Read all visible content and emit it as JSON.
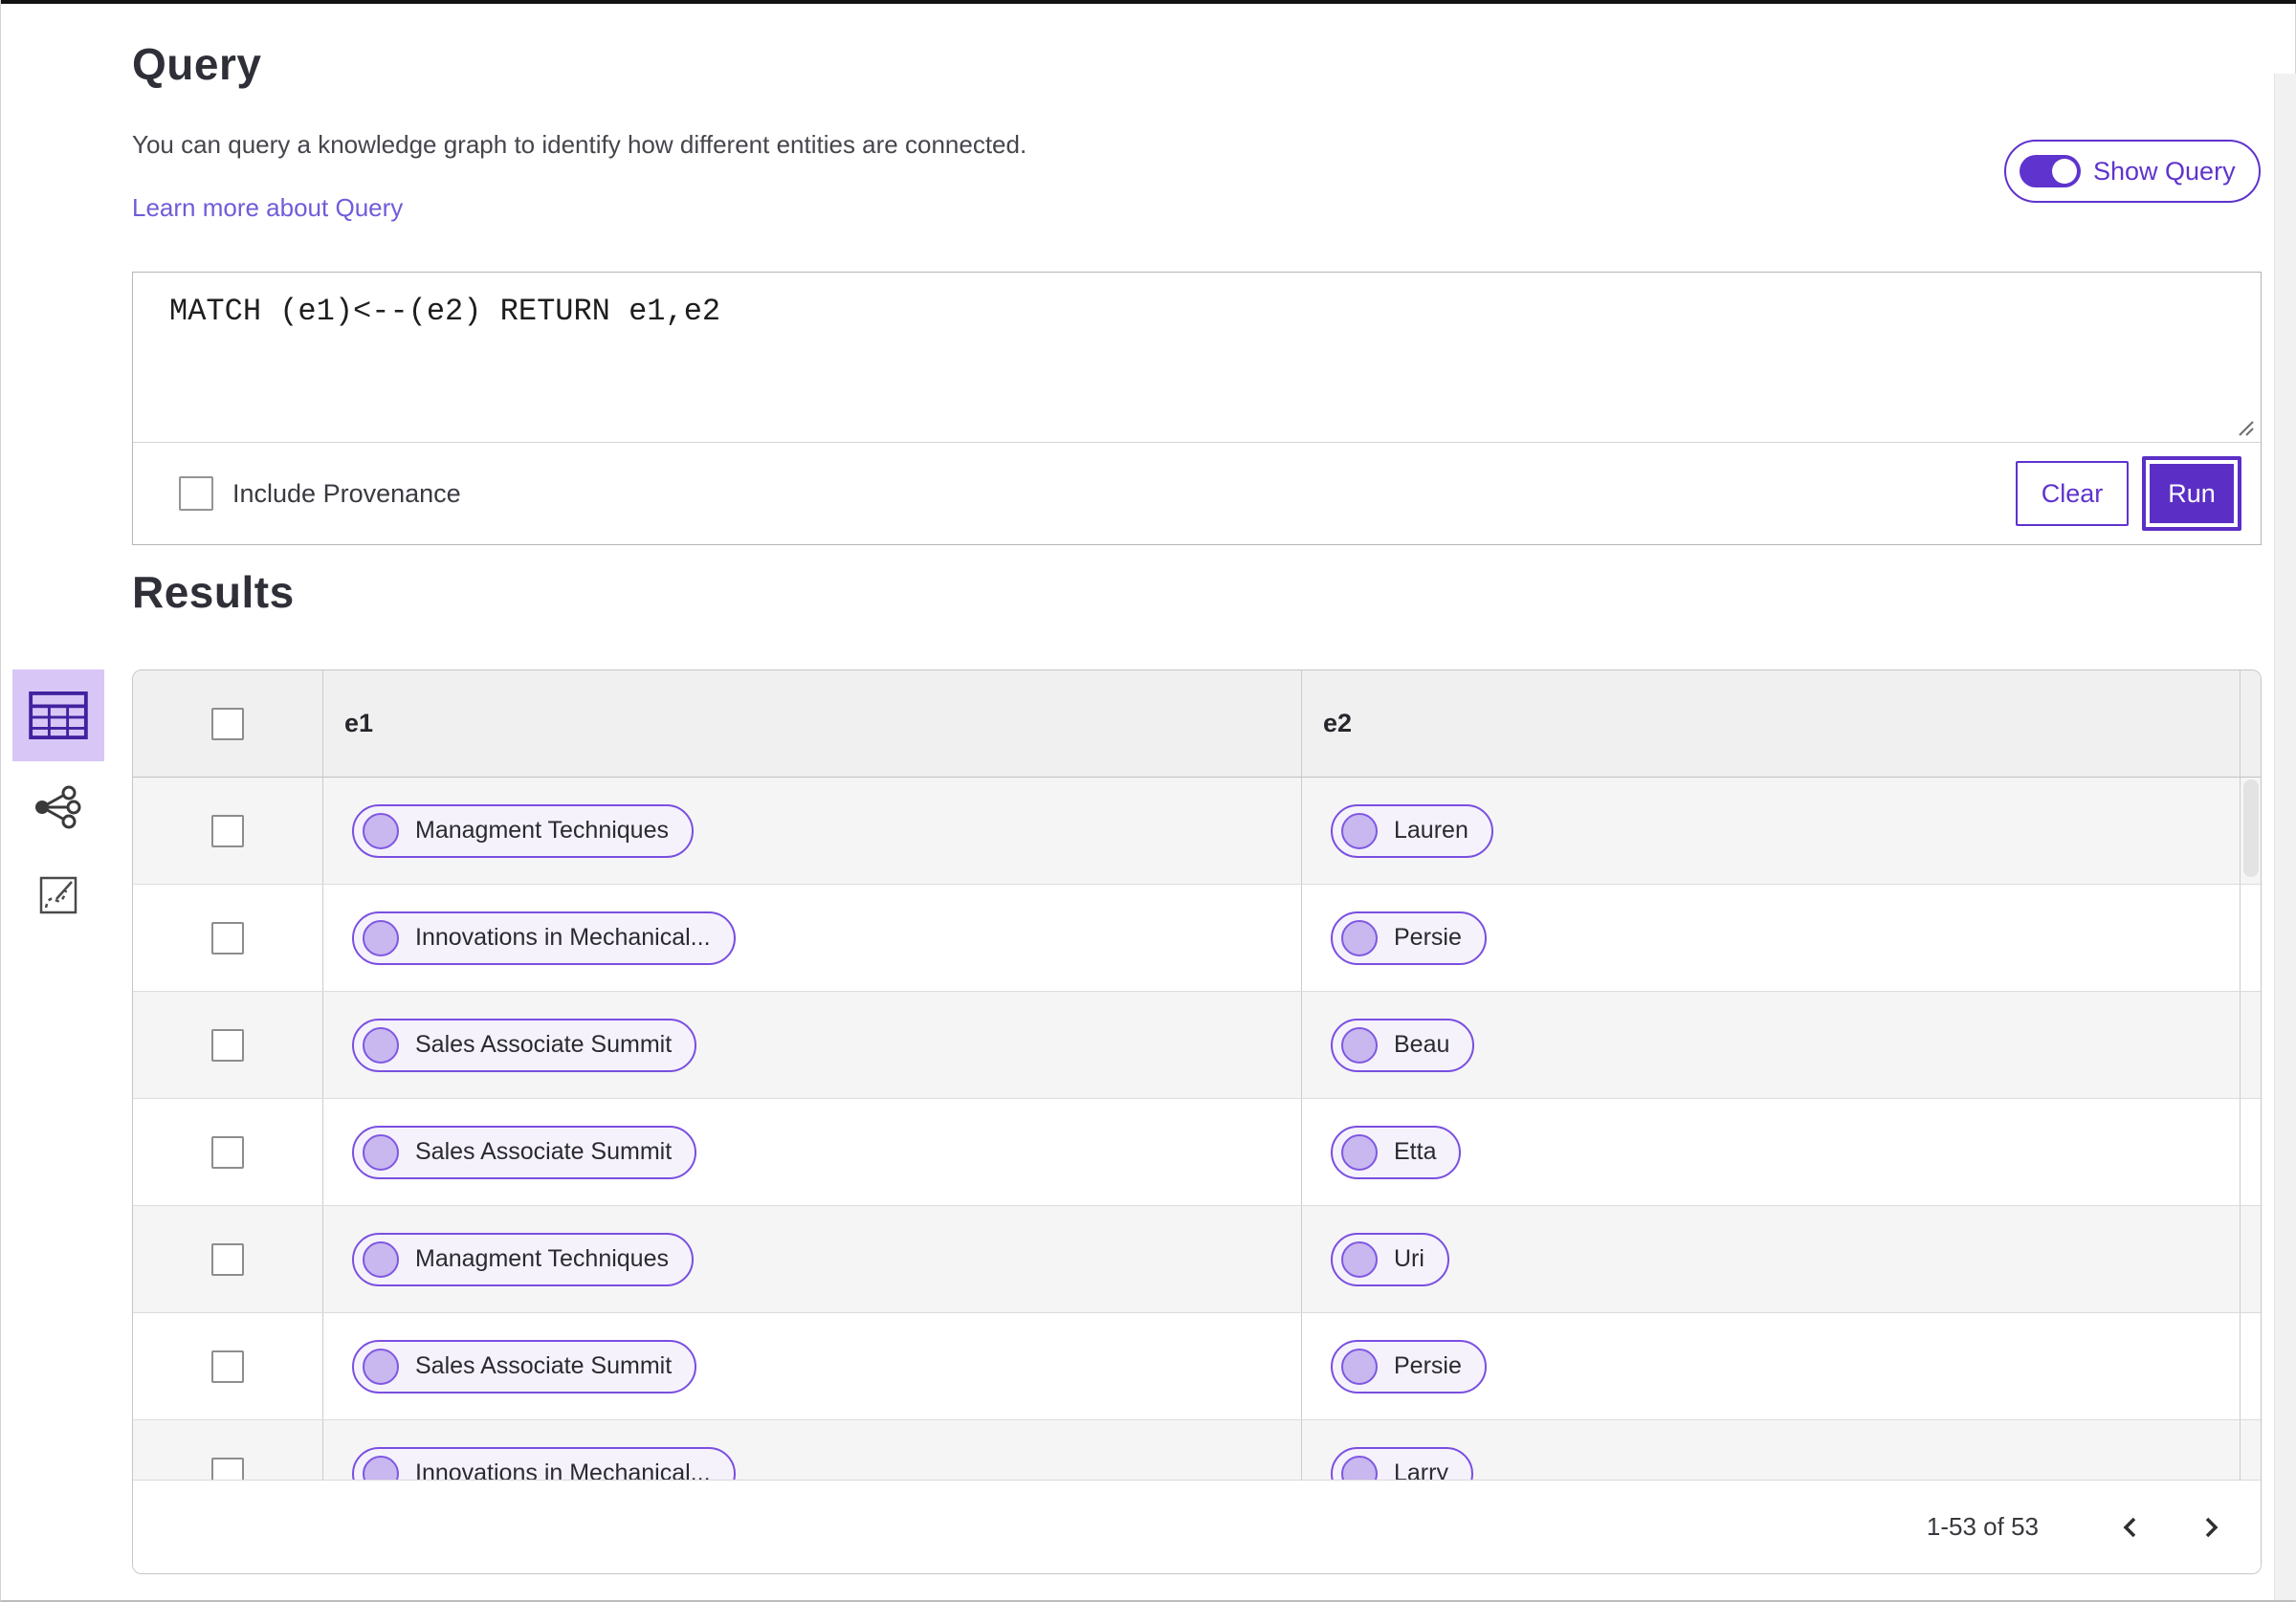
{
  "header": {
    "title": "Query",
    "description": "You can query a knowledge graph to identify how different entities are connected.",
    "learn_more_link": "Learn more about Query",
    "show_query_label": "Show Query",
    "show_query_on": true
  },
  "query_editor": {
    "query_text": "MATCH (e1)<--(e2) RETURN e1,e2",
    "include_provenance_label": "Include Provenance",
    "include_provenance_checked": false,
    "clear_button_label": "Clear",
    "run_button_label": "Run"
  },
  "results": {
    "heading": "Results",
    "views": [
      "table-view",
      "graph-view",
      "details-view"
    ],
    "selected_view": "table-view",
    "table": {
      "columns": [
        "e1",
        "e2"
      ],
      "rows": [
        {
          "e1": "Managment Techniques",
          "e2": "Lauren"
        },
        {
          "e1": "Innovations in Mechanical...",
          "e2": "Persie"
        },
        {
          "e1": "Sales Associate Summit",
          "e2": "Beau"
        },
        {
          "e1": "Sales Associate Summit",
          "e2": "Etta"
        },
        {
          "e1": "Managment Techniques",
          "e2": "Uri"
        },
        {
          "e1": "Sales Associate Summit",
          "e2": "Persie"
        },
        {
          "e1": "Innovations in Mechanical...",
          "e2": "Larry"
        }
      ]
    },
    "pagination": {
      "range_label": "1-53 of 53"
    }
  },
  "colors": {
    "accent_purple": "#5f33cd",
    "run_button_fill": "#5b2fc6",
    "pill_border": "#7a4fe0",
    "pill_background": "#f5f2fc",
    "pill_circle_fill": "#c9b7f0",
    "selected_view_background": "#d8c7f6",
    "link_purple": "#6f5cd9",
    "header_row_background": "#f0f0f0",
    "stripe_row_background": "#f5f5f5"
  }
}
